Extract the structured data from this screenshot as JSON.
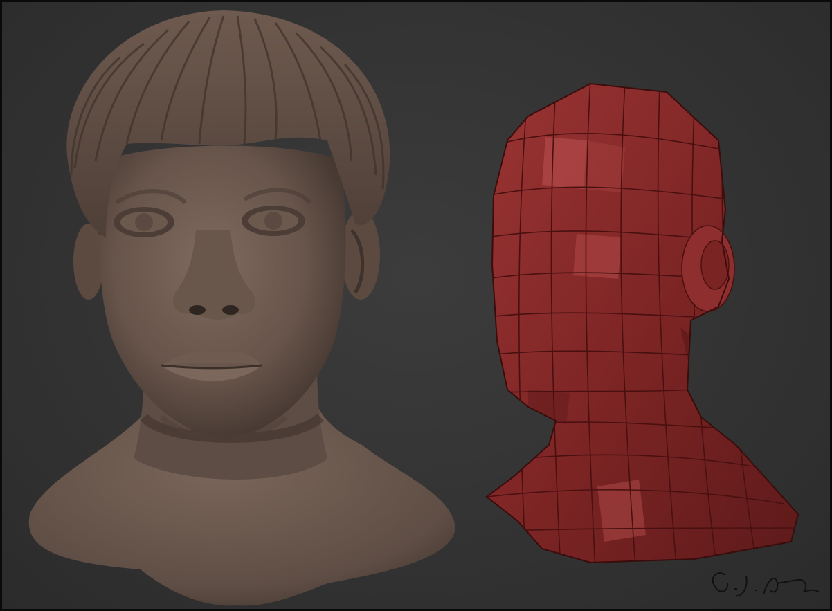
{
  "scene": {
    "background_color": "#363636",
    "frame_color": "#0a0a0a"
  },
  "sculpted_head": {
    "clay_color": "#6b584d",
    "highlight_color": "#8a766a",
    "shadow_color": "#3e322c"
  },
  "base_mesh_head": {
    "mesh_color": "#8a2a2a",
    "highlight_color": "#b04848",
    "wireframe_color": "#4a1010"
  },
  "signature": {
    "text": "G.J.Alva",
    "color": "#111111"
  }
}
